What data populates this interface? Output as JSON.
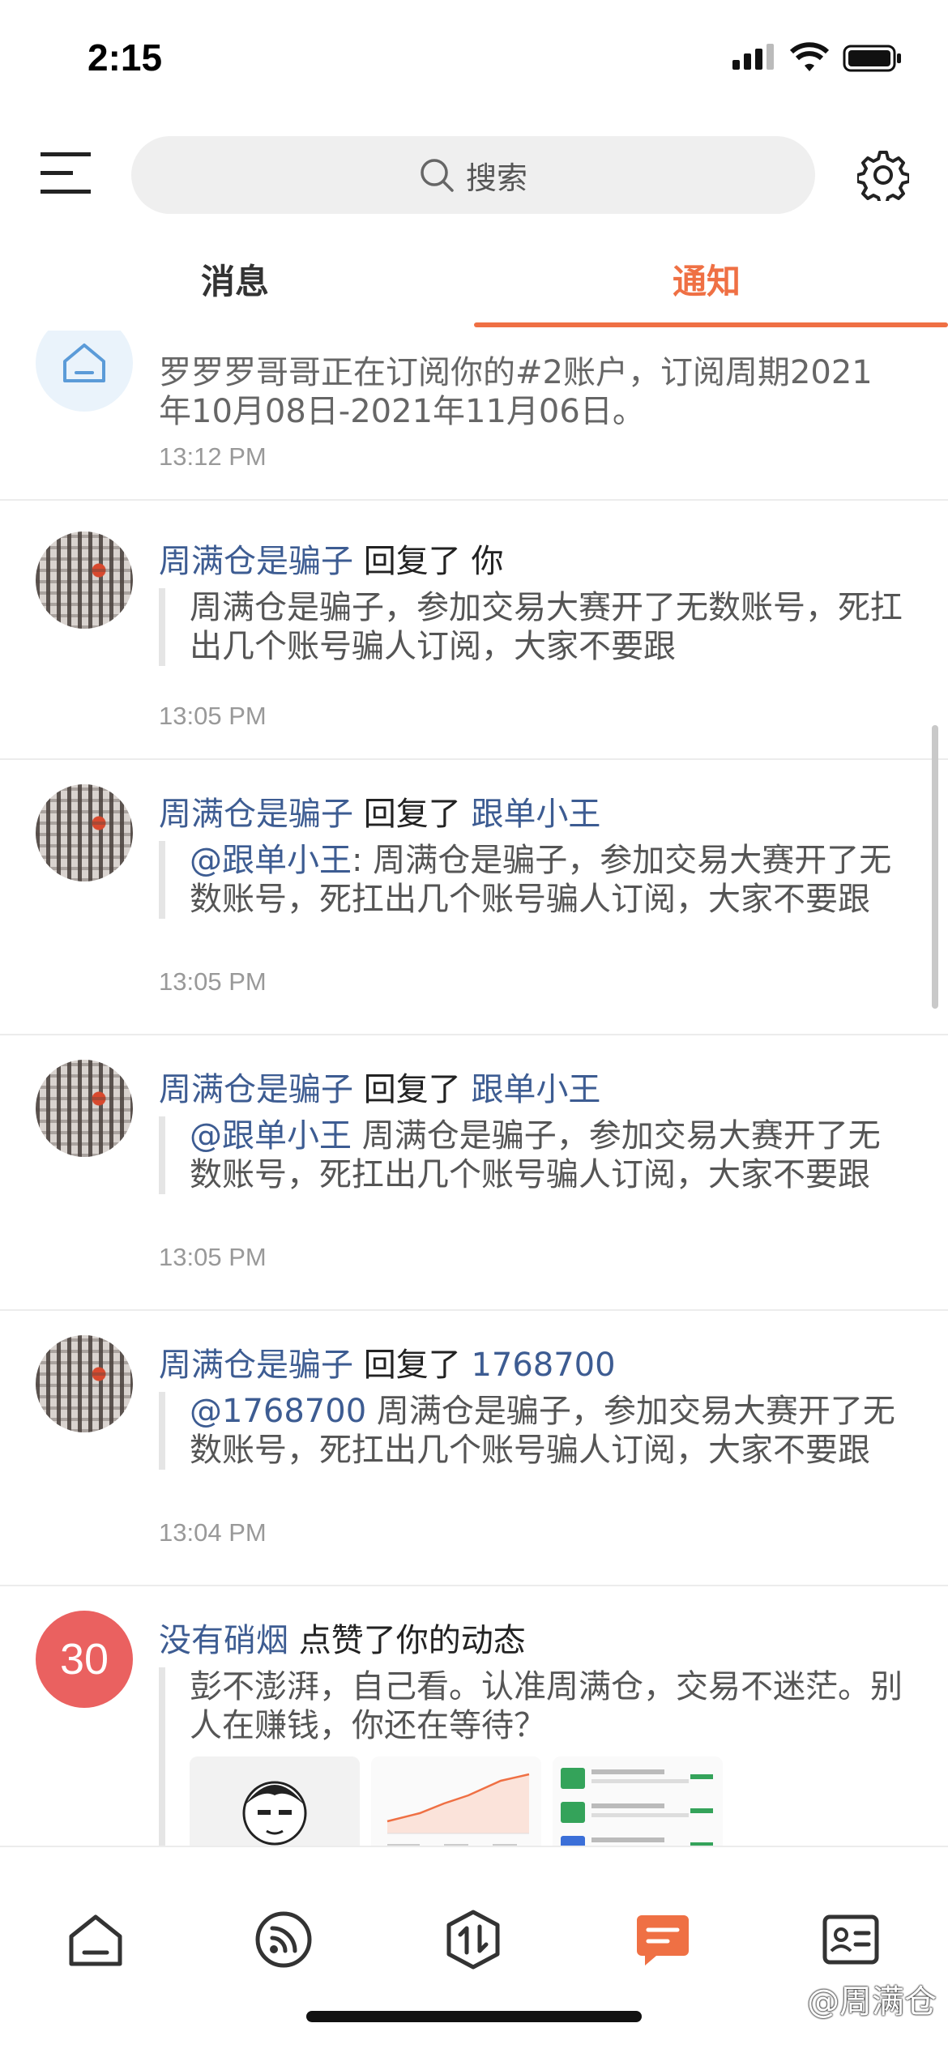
{
  "status_bar": {
    "time": "2:15"
  },
  "search": {
    "placeholder": "搜索"
  },
  "tabs": [
    {
      "label": "消息",
      "active": false
    },
    {
      "label": "通知",
      "active": true
    }
  ],
  "accent_color": "#ef7044",
  "notifications": [
    {
      "avatar": "system-home-icon",
      "title_partial": "罗罗罗哥哥正在订阅你的#2账户",
      "body": "罗罗罗哥哥正在订阅你的#2账户，订阅周期2021年10月08日-2021年11月06日。",
      "time": "13:12 PM"
    },
    {
      "user": "周满仓是骗子",
      "action": "回复了",
      "target": "你",
      "quote": "周满仓是骗子，参加交易大赛开了无数账号，死扛出几个账号骗人订阅，大家不要跟",
      "time": "13:05 PM"
    },
    {
      "user": "周满仓是骗子",
      "action": "回复了",
      "target": "跟单小王",
      "quote_mention": "@跟单小王",
      "quote": ": 周满仓是骗子，参加交易大赛开了无数账号，死扛出几个账号骗人订阅，大家不要跟",
      "time": "13:05 PM"
    },
    {
      "user": "周满仓是骗子",
      "action": "回复了",
      "target": "跟单小王",
      "quote_mention": "@跟单小王",
      "quote": " 周满仓是骗子，参加交易大赛开了无数账号，死扛出几个账号骗人订阅，大家不要跟",
      "time": "13:05 PM"
    },
    {
      "user": "周满仓是骗子",
      "action": "回复了",
      "target": "1768700",
      "quote_mention": "@1768700",
      "quote": " 周满仓是骗子，参加交易大赛开了无数账号，死扛出几个账号骗人订阅，大家不要跟",
      "time": "13:04 PM"
    },
    {
      "avatar_text": "30",
      "user": "没有硝烟",
      "action": "点赞了你的动态",
      "quote": "彭不澎湃，自己看。认准周满仓，交易不迷茫。别人在赚钱，你还在等待？",
      "thumbs": [
        "meme-image",
        "chart-image",
        "trade-list-image"
      ]
    }
  ],
  "bottom_nav": [
    {
      "icon": "home-icon"
    },
    {
      "icon": "feed-icon"
    },
    {
      "icon": "trade-icon"
    },
    {
      "icon": "message-icon",
      "active": true
    },
    {
      "icon": "profile-card-icon"
    }
  ],
  "watermark": "@周满仓"
}
